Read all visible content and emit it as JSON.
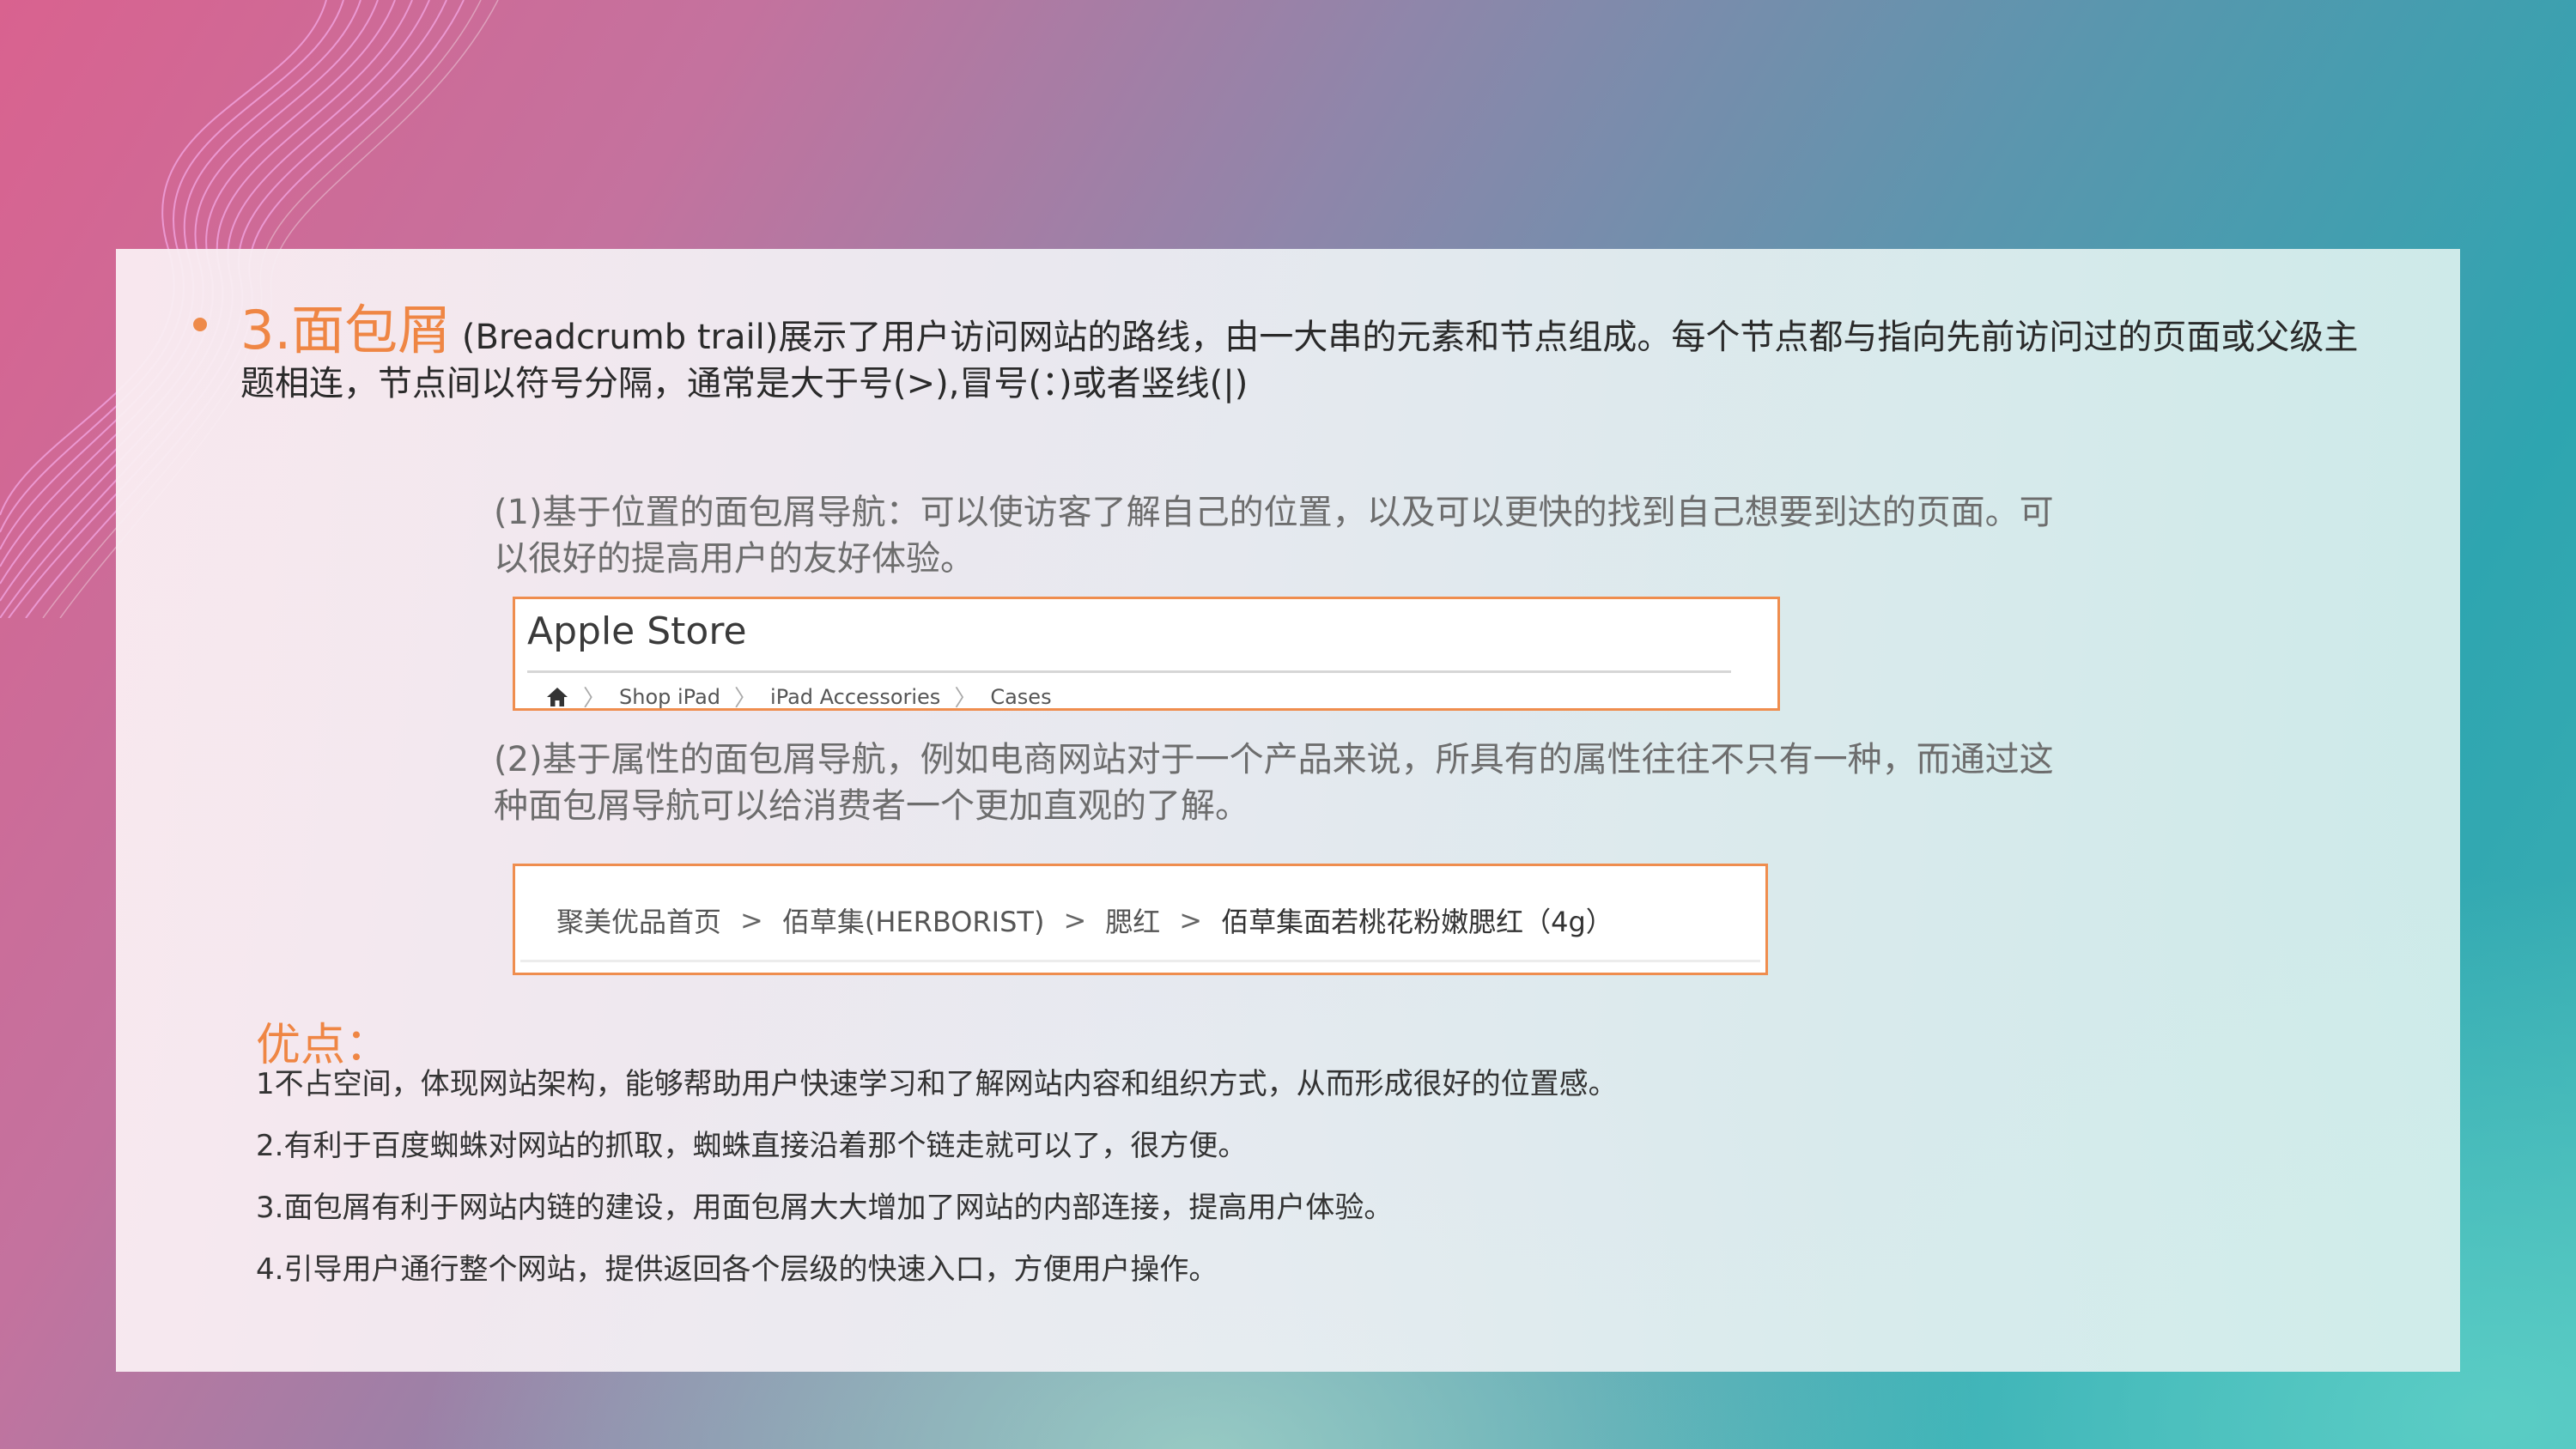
{
  "slide": {
    "heading": "3.面包屑",
    "intro_text": " (Breadcrumb trail)展示了用户访问网站的路线，由一大串的元素和节点组成。每个节点都与指向先前访问过的页面或父级主题相连，节点间以符号分隔，通常是大于号(>),冒号(：)或者竖线(|)",
    "point1": "(1)基于位置的面包屑导航：可以使访客了解自己的位置，以及可以更快的找到自己想要到达的页面。可以很好的提高用户的友好体验。",
    "example1": {
      "title": "Apple Store",
      "crumbs": [
        "Shop iPad",
        "iPad Accessories",
        "Cases"
      ]
    },
    "point2": "(2)基于属性的面包屑导航，例如电商网站对于一个产品来说，所具有的属性往往不只有一种，而通过这种面包屑导航可以给消费者一个更加直观的了解。",
    "example2": {
      "crumbs": [
        "聚美优品首页",
        "佰草集(HERBORIST)",
        "腮红",
        "佰草集面若桃花粉嫩腮红（4g）"
      ],
      "separator": ">"
    },
    "advantages_title": "优点：",
    "advantages": [
      "1不占空间，体现网站架构，能够帮助用户快速学习和了解网站内容和组织方式，从而形成很好的位置感。",
      "2.有利于百度蜘蛛对网站的抓取，蜘蛛直接沿着那个链走就可以了，很方便。",
      "3.面包屑有利于网站内链的建设，用面包屑大大增加了网站的内部连接，提高用户体验。",
      "4.引导用户通行整个网站，提供返回各个层级的快速入口，方便用户操作。"
    ]
  },
  "colors": {
    "accent": "#ef8644",
    "box_border": "#ef8d4e"
  },
  "icons": [
    "home-icon",
    "chevron-right-icon"
  ]
}
